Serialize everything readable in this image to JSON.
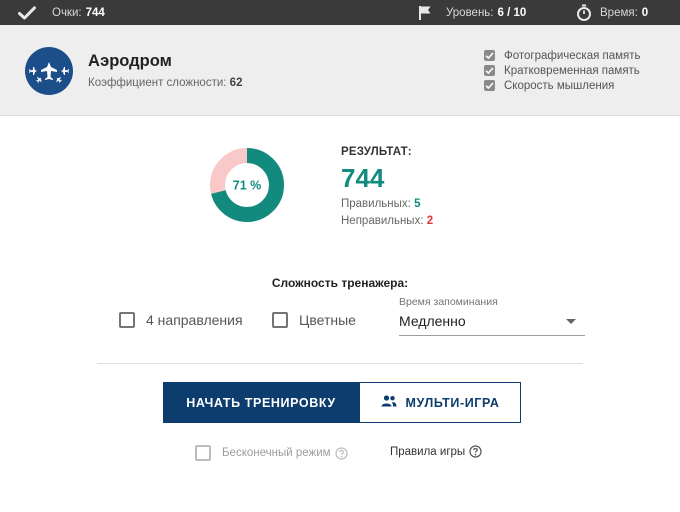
{
  "topbar": {
    "score_label": "Очки:",
    "score_value": "744",
    "level_label": "Уровень:",
    "level_value": "6 / 10",
    "time_label": "Время:",
    "time_value": "0"
  },
  "header": {
    "title": "Аэродром",
    "coef_label": "Коэффициент сложности:",
    "coef_value": "62",
    "skills": [
      "Фотографическая память",
      "Кратковременная память",
      "Скорость мышления"
    ]
  },
  "result": {
    "percent_label": "71 %",
    "percent": 0.71,
    "label": "РЕЗУЛЬТАТ:",
    "score": "744",
    "correct_label": "Правильных:",
    "correct_value": "5",
    "wrong_label": "Неправильных:",
    "wrong_value": "2"
  },
  "difficulty": {
    "title": "Сложность тренажера:",
    "option_directions": "4 направления",
    "option_colored": "Цветные",
    "select_label": "Время запоминания",
    "select_value": "Медленно"
  },
  "actions": {
    "start": "НАЧАТЬ ТРЕНИРОВКУ",
    "multi": "МУЛЬТИ-ИГРА",
    "endless": "Бесконечный режим",
    "rules": "Правила игры"
  },
  "colors": {
    "topbar": "#3a3a3a",
    "accent": "#128a7e",
    "donut_rest": "#f9c9c9",
    "primary": "#0d3c6e",
    "wrong": "#e53935"
  },
  "icons": {
    "score": "checkmark-icon",
    "level": "flag-icon",
    "time": "stopwatch-icon",
    "multi": "people-icon",
    "help": "question-circle-icon"
  }
}
